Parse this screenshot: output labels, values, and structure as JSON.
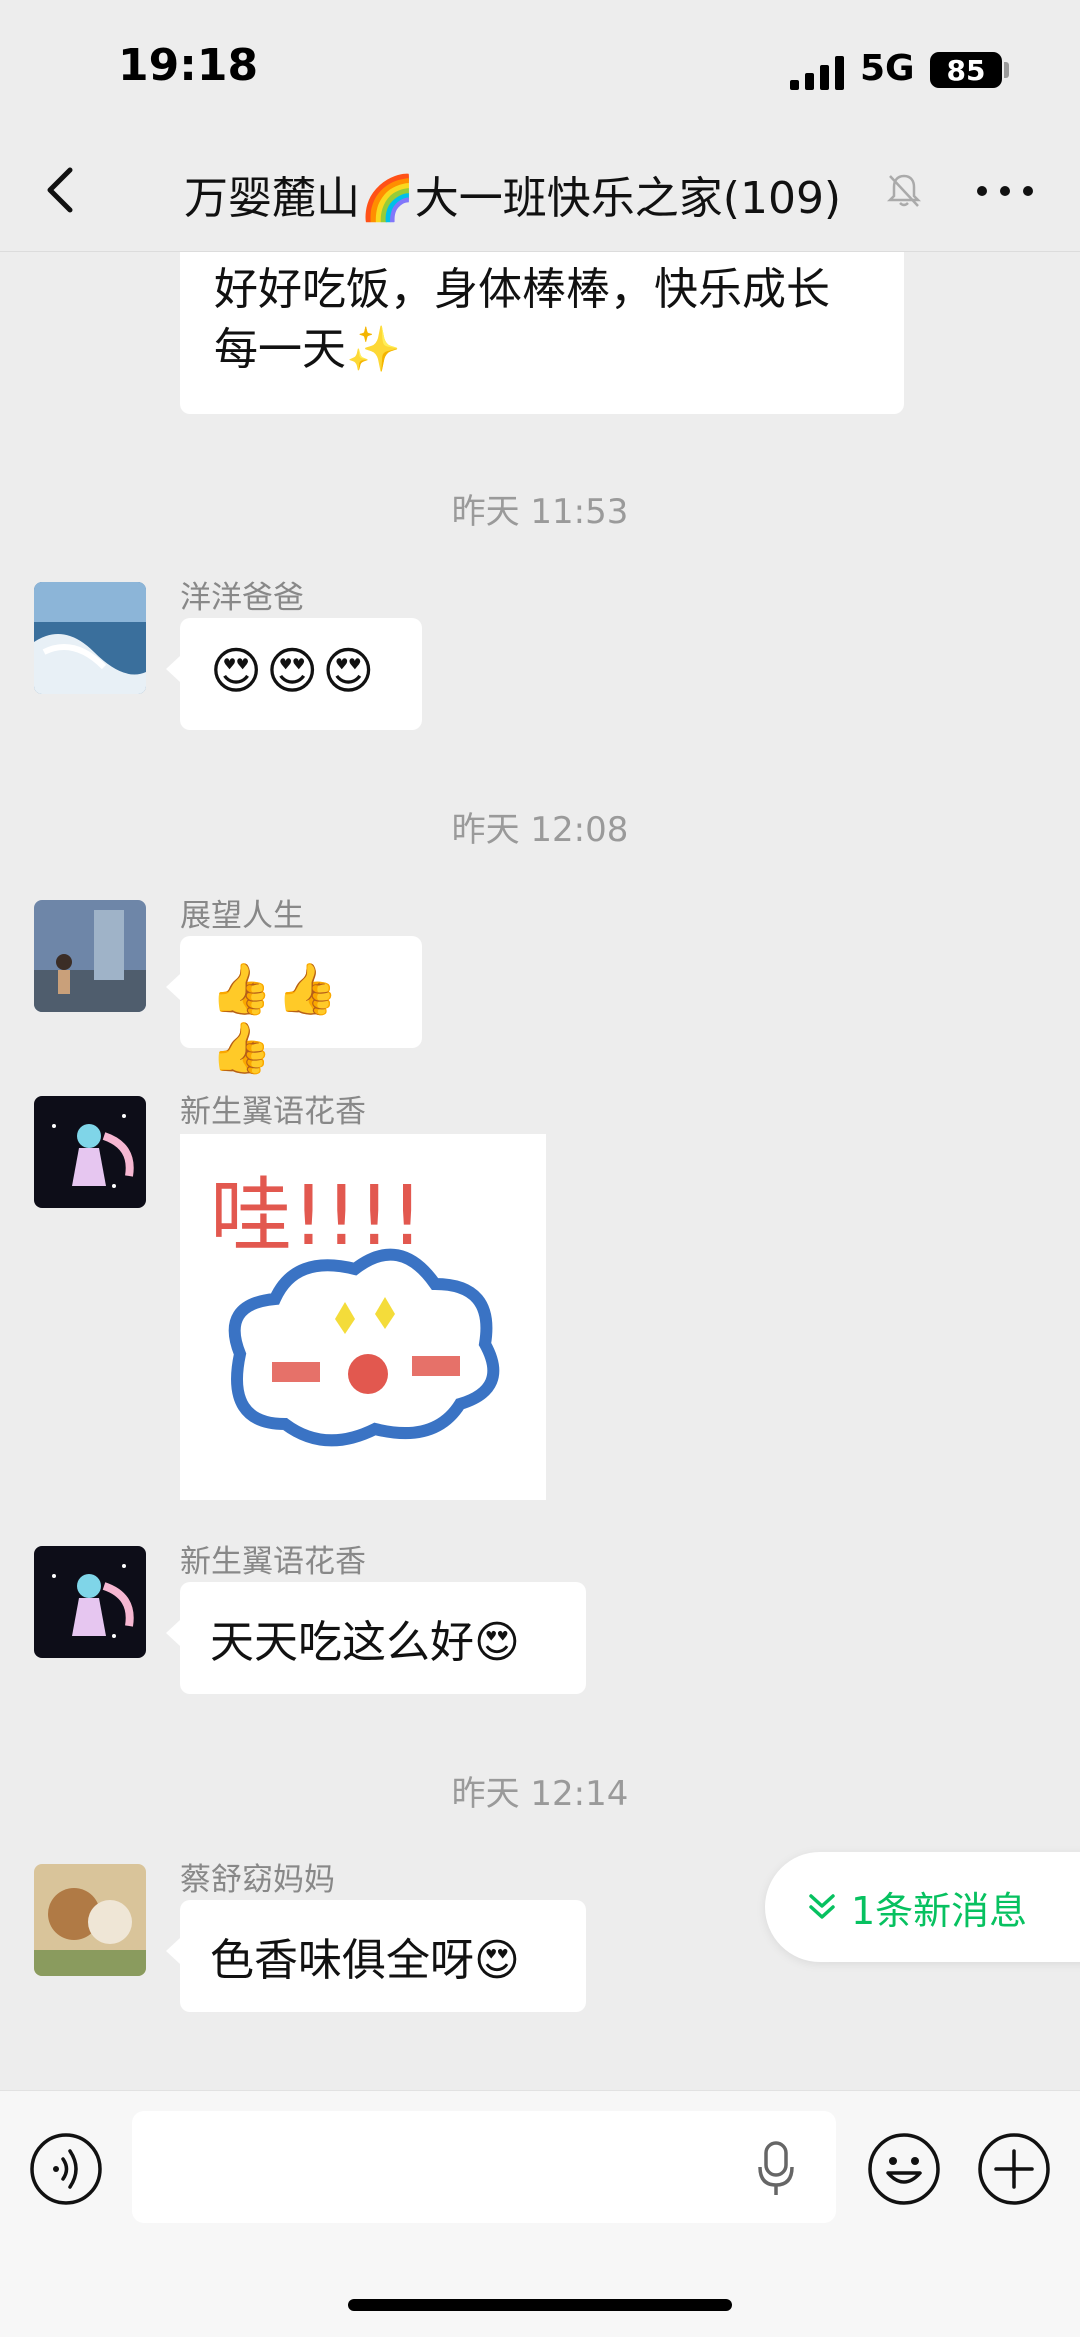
{
  "status_bar": {
    "time": "19:18",
    "network": "5G",
    "battery": "85"
  },
  "header": {
    "title": "万婴麓山🌈大一班快乐之家(109)",
    "back_icon": "chevron-left-icon",
    "mute_icon": "bell-off-icon",
    "more_icon": "more-dots-icon"
  },
  "messages": {
    "partial_top": {
      "line1": "好好吃饭，身体棒棒，快乐成长",
      "line2": "每一天✨"
    },
    "timestamp_1": "昨天 11:53",
    "msg_1": {
      "sender": "洋洋爸爸",
      "text": "😍😍😍"
    },
    "timestamp_2": "昨天 12:08",
    "msg_2": {
      "sender": "展望人生",
      "text": "👍👍👍"
    },
    "msg_3": {
      "sender": "新生翼语花香",
      "sticker_text": "哇!!!!"
    },
    "msg_4": {
      "sender": "新生翼语花香",
      "text": "天天吃这么好😍"
    },
    "timestamp_3": "昨天 12:14",
    "msg_5": {
      "sender": "蔡舒窈妈妈",
      "text": "色香味俱全呀😍"
    }
  },
  "new_message_pill": {
    "label": "1条新消息"
  },
  "input_bar": {
    "placeholder": "",
    "voice_icon": "voice-icon",
    "mic_icon": "microphone-icon",
    "emoji_icon": "emoji-icon",
    "plus_icon": "plus-icon"
  },
  "colors": {
    "accent": "#07c160",
    "background": "#ededed",
    "bubble": "#ffffff"
  }
}
